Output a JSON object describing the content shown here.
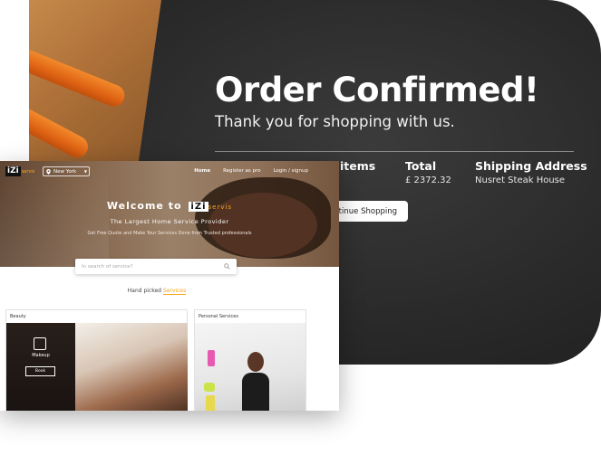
{
  "order": {
    "title": "Order Confirmed!",
    "subtitle": "Thank you for shopping with us.",
    "columns": {
      "items_label": "items",
      "total_label": "Total",
      "total_value": "£ 2372.32",
      "address_label": "Shipping Address",
      "address_value": "Nusret Steak House"
    },
    "continue_label": "ontinue Shopping"
  },
  "site": {
    "logo_mark": "iZi",
    "logo_word": "servis",
    "city": "New York",
    "nav": {
      "home": "Home",
      "register": "Register as pro",
      "login": "Login / signup"
    },
    "hero": {
      "welcome": "Welcome to",
      "brand_mark": "iZi",
      "brand_word": "servis",
      "tagline": "The Largest Home Service Provider",
      "subline": "Get Free Quote and Make Your Services Done from Trusted professionals"
    },
    "search": {
      "placeholder": "In search of service?"
    },
    "hand_picked": {
      "prefix": "Hand picked",
      "accent": "Services"
    },
    "categories": [
      {
        "title": "Beauty",
        "tile_label": "Makeup",
        "book_label": "Book"
      },
      {
        "title": "Personal Services"
      }
    ]
  },
  "colors": {
    "accent": "#f5a623",
    "chalkboard": "#2a2a2a",
    "white": "#ffffff"
  }
}
